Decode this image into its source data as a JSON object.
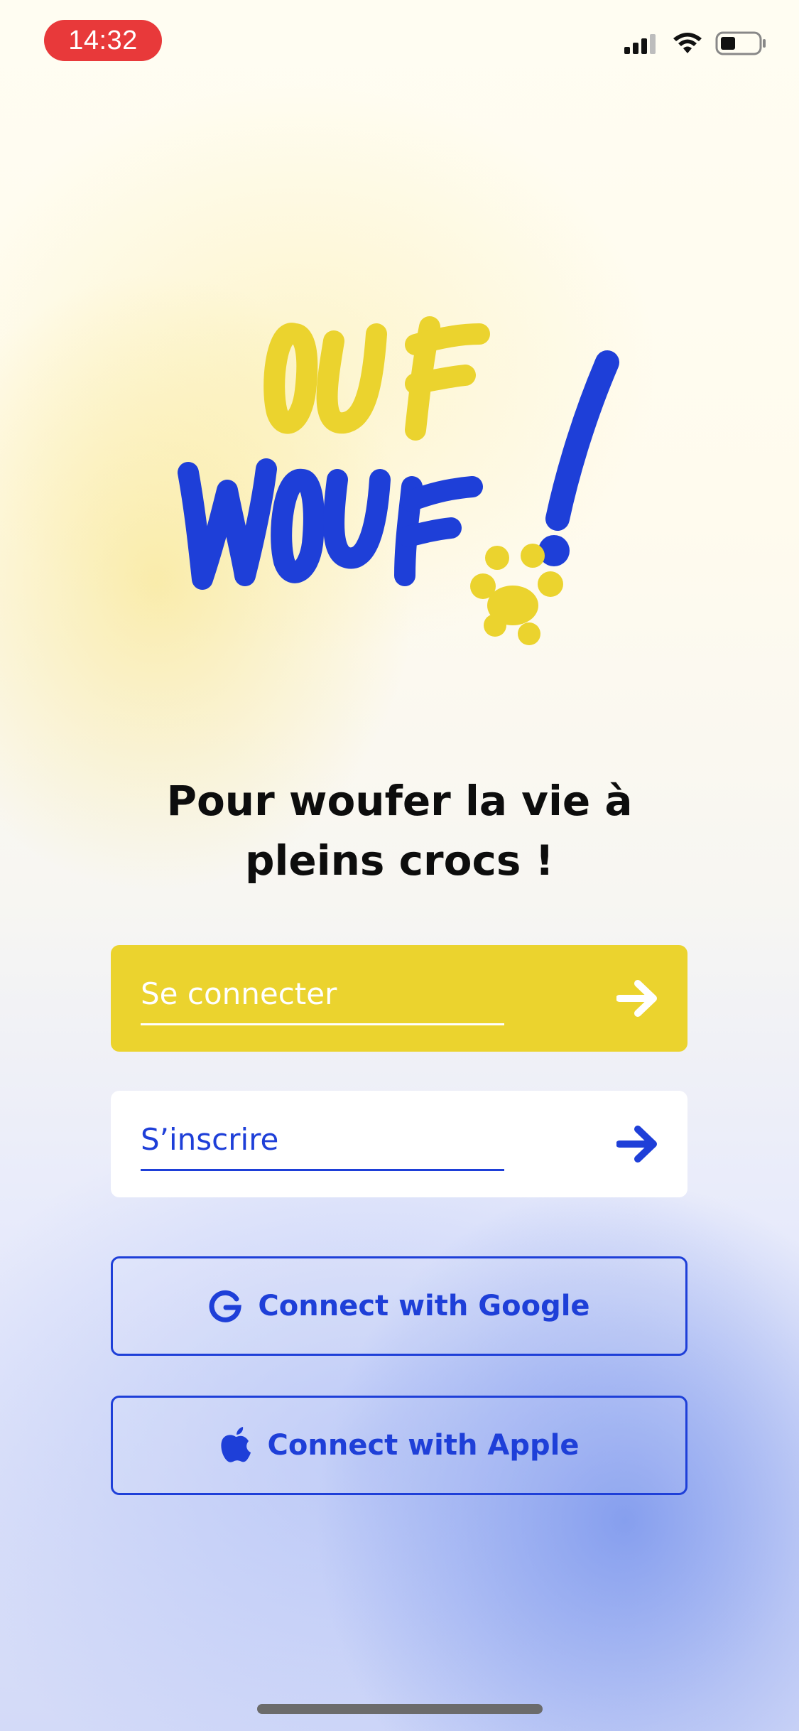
{
  "status_bar": {
    "time": "14:32",
    "icons": [
      "signal-icon",
      "wifi-icon",
      "battery-icon"
    ]
  },
  "logo": {
    "line1": "OUF",
    "line2": "WOUF",
    "mark": "!"
  },
  "tagline": {
    "line1": "Pour woufer la vie à",
    "line2": "pleins crocs !"
  },
  "buttons": {
    "login": {
      "label": "Se connecter",
      "icon": "arrow-right-icon"
    },
    "signup": {
      "label": "S’inscrire",
      "icon": "arrow-right-icon"
    },
    "google": {
      "label": "Connect with Google",
      "icon": "google-icon"
    },
    "apple": {
      "label": "Connect with Apple",
      "icon": "apple-icon"
    }
  },
  "colors": {
    "brand_yellow": "#ebd32e",
    "brand_blue": "#1e3fd8",
    "time_pill": "#e8393a"
  }
}
